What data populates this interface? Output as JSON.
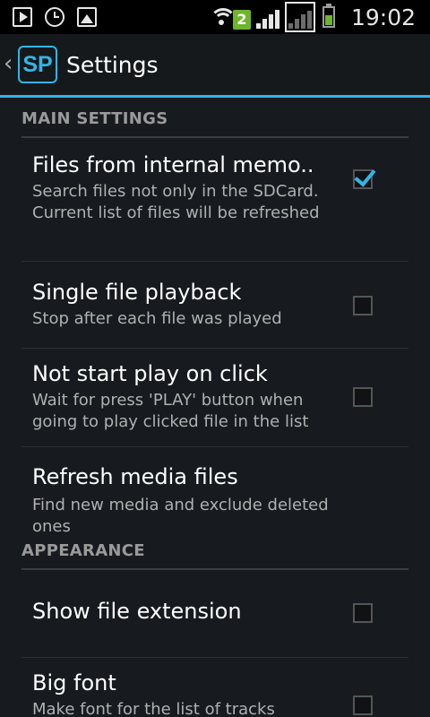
{
  "status_bar": {
    "sim_badge": "2",
    "time": "19:02",
    "icons": [
      "play-icon",
      "alarm-icon",
      "image-icon",
      "wifi-icon",
      "signal-icon",
      "battery-icon"
    ]
  },
  "action_bar": {
    "logo_text": "SP",
    "title": "Settings"
  },
  "sections": [
    {
      "header": "MAIN SETTINGS",
      "items": [
        {
          "title": "Files from internal memo..",
          "summary": "Search files not only in the SDCard. Current list of files will be refreshed",
          "checkbox": true,
          "checked": true
        },
        {
          "title": "Single file playback",
          "summary": "Stop after each file was played",
          "checkbox": true,
          "checked": false
        },
        {
          "title": "Not start play on click",
          "summary": "Wait for press 'PLAY' button when going to play clicked file in the list",
          "checkbox": true,
          "checked": false
        },
        {
          "title": "Refresh media files",
          "summary": "Find new media and exclude deleted ones",
          "checkbox": false,
          "checked": false
        }
      ]
    },
    {
      "header": "APPEARANCE",
      "items": [
        {
          "title": "Show file extension",
          "summary": "",
          "checkbox": true,
          "checked": false
        },
        {
          "title": "Big font",
          "summary": "Make font for the list of tracks",
          "checkbox": true,
          "checked": false
        }
      ]
    }
  ],
  "colors": {
    "accent": "#33b5e5",
    "background": "#171b1f",
    "sim_badge": "#6fb42c"
  }
}
